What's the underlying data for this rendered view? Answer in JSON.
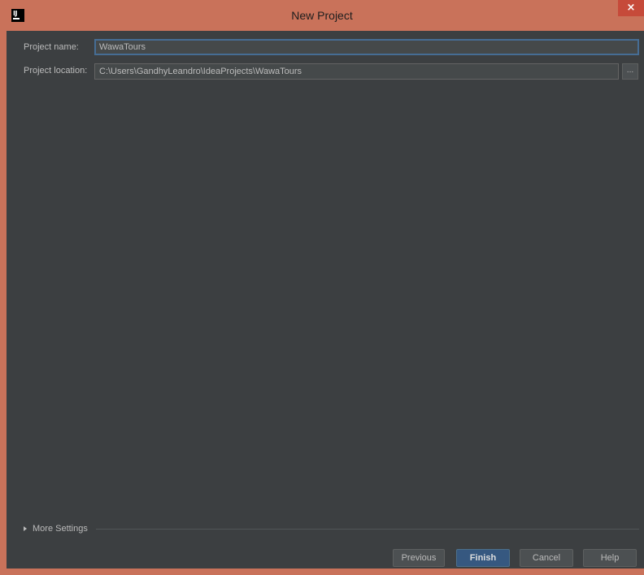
{
  "window": {
    "title": "New Project",
    "app_icon_text": "IJ",
    "close_glyph": "×"
  },
  "form": {
    "name_label": "Project name:",
    "name_value": "WawaTours",
    "location_label": "Project location:",
    "location_value": "C:\\Users\\GandhyLeandro\\IdeaProjects\\WawaTours",
    "browse_label": "..."
  },
  "more_settings": {
    "label": "More Settings"
  },
  "buttons": {
    "previous": "Previous",
    "finish": "Finish",
    "cancel": "Cancel",
    "help": "Help"
  },
  "colors": {
    "titlebar": "#c9725a",
    "close_button": "#c64a3a",
    "panel_background": "#3c3f41",
    "focused_border": "#466d94",
    "default_button": "#365880"
  },
  "icons": {
    "app": "intellij-idea-icon",
    "close": "close-icon",
    "expand": "triangle-right-icon"
  }
}
